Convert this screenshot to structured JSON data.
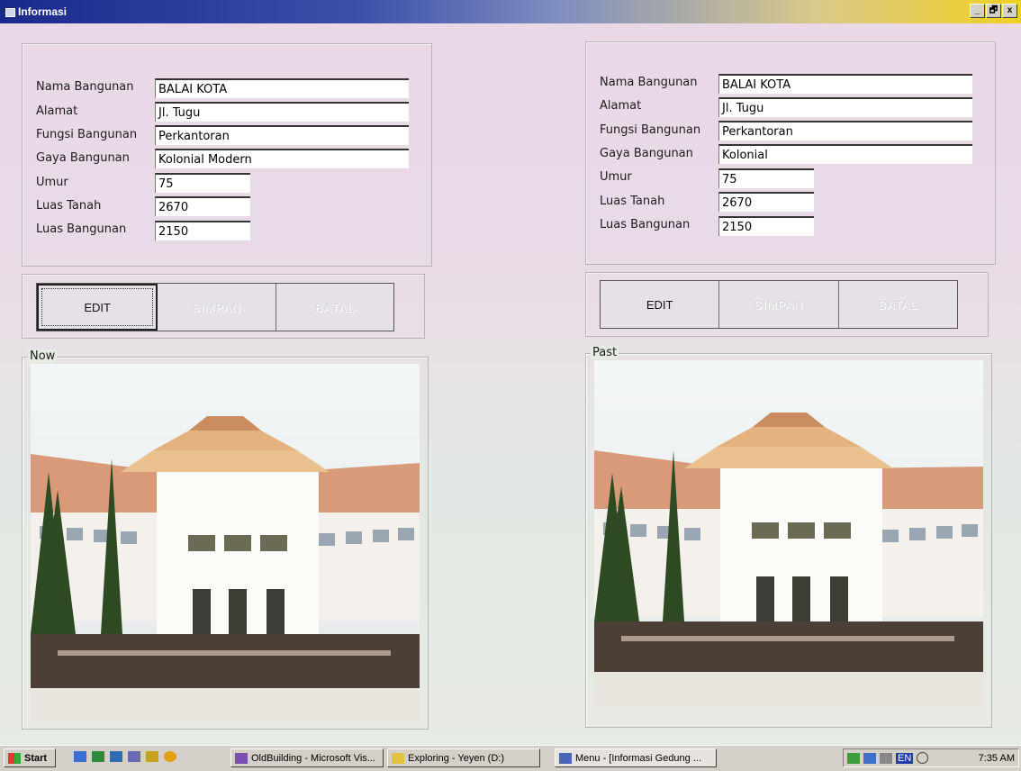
{
  "window": {
    "title": "Informasi",
    "controls": [
      "_",
      "🗗",
      "x"
    ]
  },
  "labels": {
    "nama": "Nama Bangunan",
    "alamat": "Alamat",
    "fungsi": "Fungsi Bangunan",
    "gaya": "Gaya Bangunan",
    "umur": "Umur",
    "luas_tanah": "Luas Tanah",
    "luas_bangunan": "Luas Bangunan"
  },
  "now": {
    "nama": "BALAI KOTA",
    "alamat": "Jl. Tugu",
    "fungsi": "Perkantoran",
    "gaya": "Kolonial Modern",
    "umur": "75",
    "luas_tanah": "2670",
    "luas_bangunan": "2150",
    "frame_label": "Now"
  },
  "past": {
    "nama": "BALAI KOTA",
    "alamat": "Jl. Tugu",
    "fungsi": "Perkantoran",
    "gaya": "Kolonial",
    "umur": "75",
    "luas_tanah": "2670",
    "luas_bangunan": "2150",
    "frame_label": "Past"
  },
  "buttons": {
    "edit": "EDIT",
    "simpan": "SIMPAN",
    "batal": "BATAL"
  },
  "taskbar": {
    "start": "Start",
    "tasks": [
      "OldBuilding - Microsoft Vis...",
      "Exploring - Yeyen (D:)",
      "Menu - [Informasi Gedung ..."
    ],
    "lang": "EN",
    "clock": "7:35 AM"
  },
  "colors": {
    "titlebar_start": "#1a2a8c",
    "titlebar_end": "#f0d020",
    "taskbar": "#d4d0c8"
  },
  "icons": [
    "window-icon",
    "minimize-icon",
    "maximize-icon",
    "close-icon",
    "start-logo-icon",
    "quicklaunch-icons",
    "tray-icons"
  ]
}
